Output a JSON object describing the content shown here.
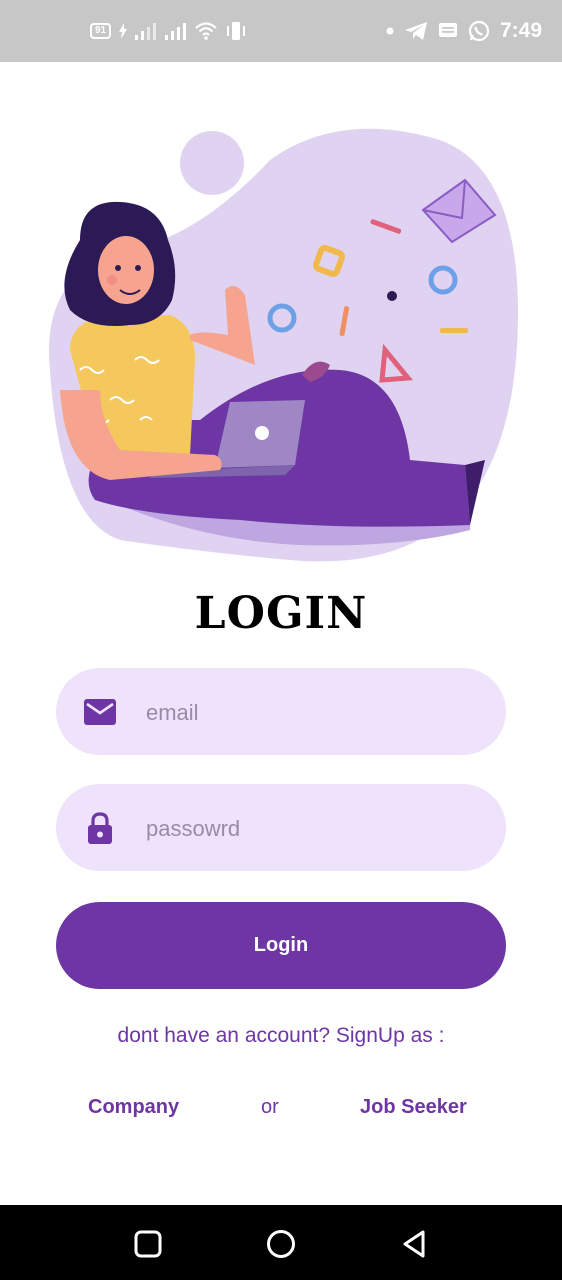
{
  "status_bar": {
    "battery": "91",
    "time": "7:49"
  },
  "page": {
    "title": "LOGIN"
  },
  "form": {
    "email_placeholder": "email",
    "email_value": "",
    "password_placeholder": "passowrd",
    "password_value": "",
    "login_label": "Login"
  },
  "signup": {
    "prompt": "dont have an account? SignUp as :",
    "company_label": "Company",
    "or_label": "or",
    "job_seeker_label": "Job Seeker"
  },
  "icons": {
    "email": "mail-icon",
    "password": "lock-icon"
  },
  "colors": {
    "accent": "#6e36a4",
    "field_bg": "#efe3fb",
    "status_bar_bg": "#c7c7c7"
  }
}
